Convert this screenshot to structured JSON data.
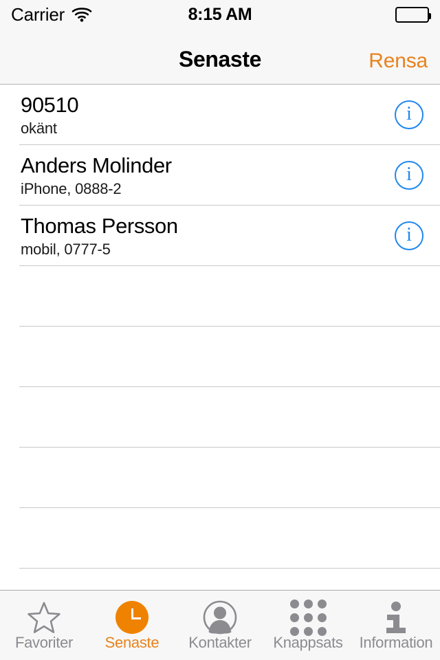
{
  "status_bar": {
    "carrier": "Carrier",
    "wifi_icon": "wifi-icon",
    "time": "8:15 AM",
    "battery_icon": "battery-full-icon"
  },
  "nav_bar": {
    "title": "Senaste",
    "action_label": "Rensa",
    "accent_color": "#e8821e"
  },
  "list": {
    "info_glyph": "i",
    "separator_color": "#c8c7cc",
    "info_color": "#1f87ee",
    "rows": [
      {
        "title": "90510",
        "subtitle": "okänt"
      },
      {
        "title": "Anders Molinder",
        "subtitle": "iPhone, 0888-2"
      },
      {
        "title": "Thomas Persson",
        "subtitle": "mobil, 0777-5"
      }
    ],
    "empty_row_count": 5
  },
  "tab_bar": {
    "active_color": "#e8821e",
    "inactive_color": "#8b8b90",
    "tabs": [
      {
        "label": "Favoriter",
        "icon": "star-outline-icon",
        "active": false
      },
      {
        "label": "Senaste",
        "icon": "clock-icon",
        "active": true
      },
      {
        "label": "Kontakter",
        "icon": "person-circle-icon",
        "active": false
      },
      {
        "label": "Knappsats",
        "icon": "dialpad-grid-icon",
        "active": false
      },
      {
        "label": "Information",
        "icon": "info-letter-icon",
        "active": false
      }
    ]
  }
}
